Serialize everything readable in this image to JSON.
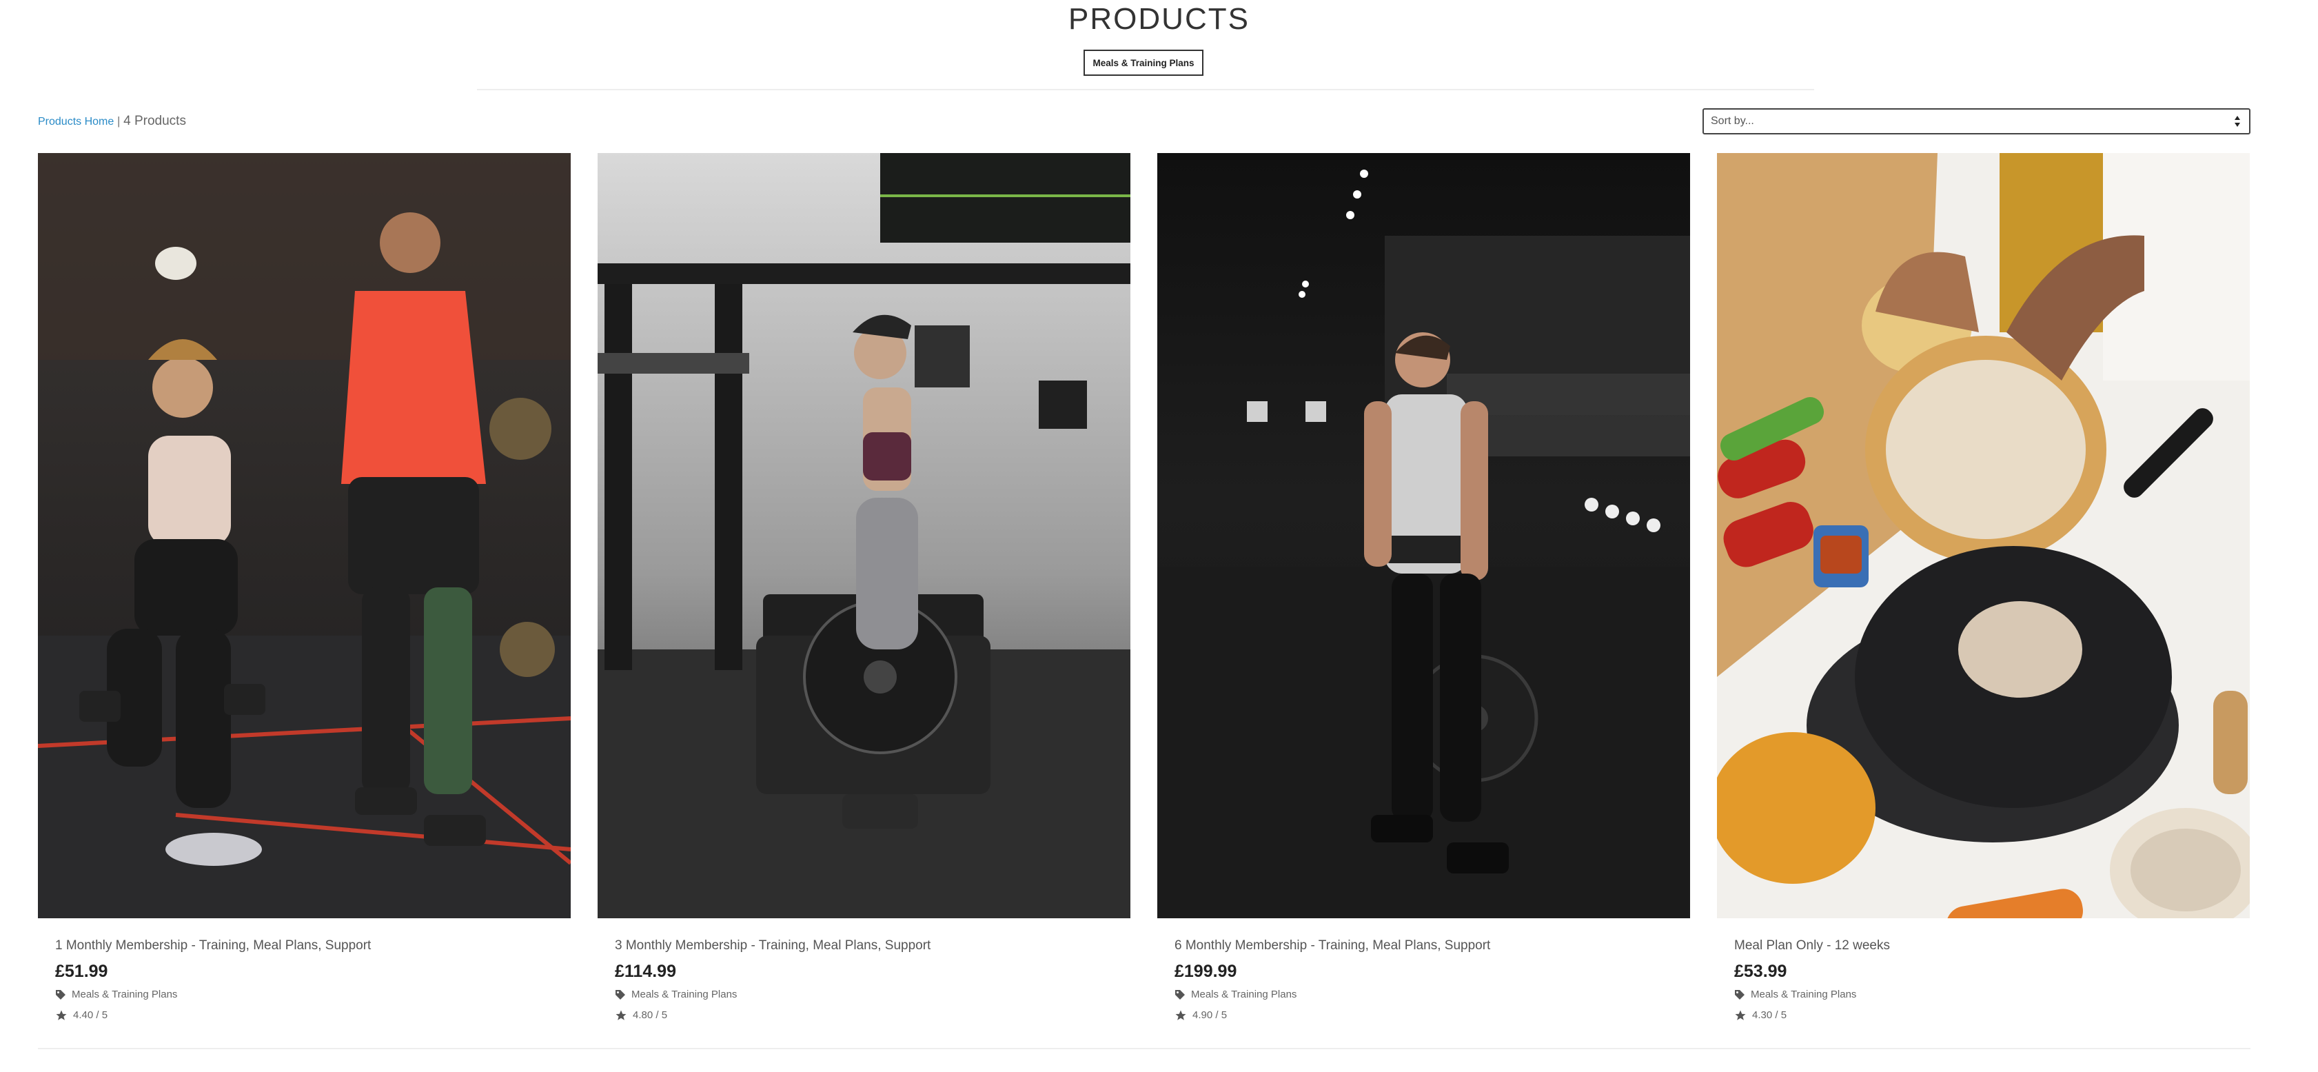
{
  "page": {
    "title": "PRODUCTS",
    "category_chip": "Meals & Training Plans"
  },
  "breadcrumb": {
    "home_label": "Products Home",
    "separator": " | ",
    "count_label": "4 Products"
  },
  "sort": {
    "placeholder": "Sort by..."
  },
  "products": [
    {
      "name": "1 Monthly Membership - Training, Meal Plans, Support",
      "price": "£51.99",
      "category": "Meals & Training Plans",
      "rating": "4.40 / 5",
      "image": "gym-couple-lunges-photo"
    },
    {
      "name": "3 Monthly Membership - Training, Meal Plans, Support",
      "price": "£114.99",
      "category": "Meals & Training Plans",
      "rating": "4.80 / 5",
      "image": "woman-with-weight-plate-photo"
    },
    {
      "name": "6 Monthly Membership - Training, Meal Plans, Support",
      "price": "£199.99",
      "category": "Meals & Training Plans",
      "rating": "4.90 / 5",
      "image": "man-with-weight-plate-photo"
    },
    {
      "name": "Meal Plan Only - 12 weeks",
      "price": "£53.99",
      "category": "Meals & Training Plans",
      "rating": "4.30 / 5",
      "image": "cooking-mushrooms-photo"
    }
  ],
  "colors": {
    "link": "#2a8bc7",
    "price": "#222222",
    "text": "#555555"
  }
}
